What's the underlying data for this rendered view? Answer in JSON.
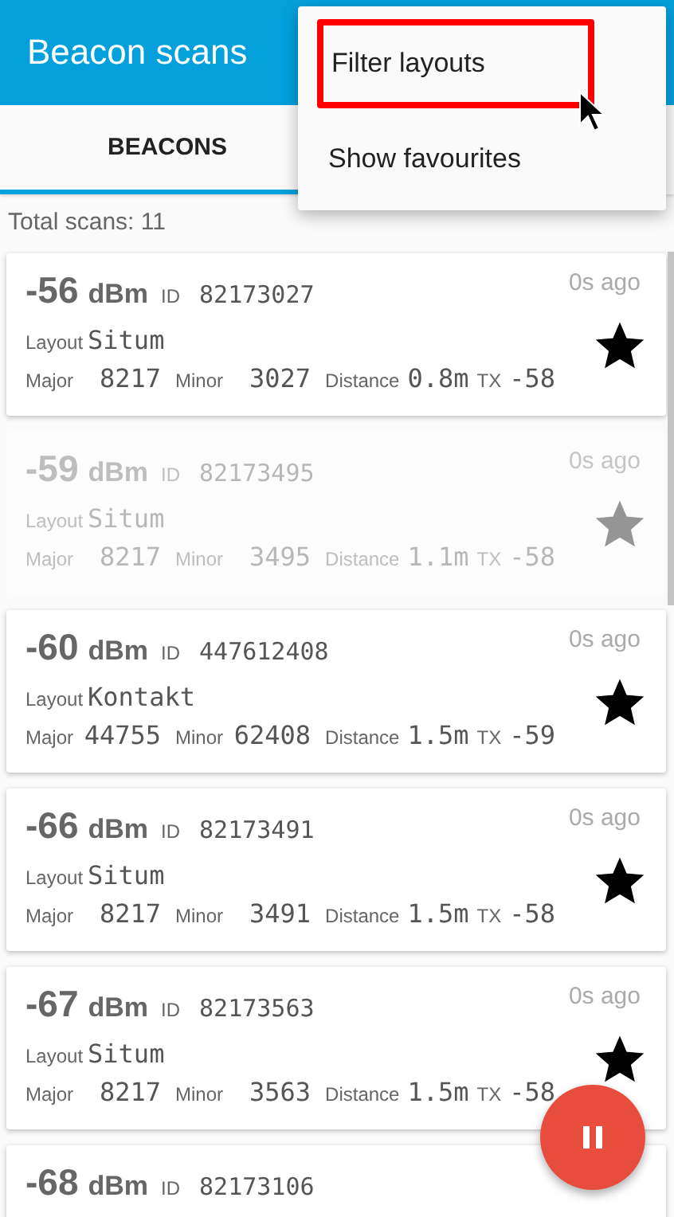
{
  "app_bar": {
    "title": "Beacon scans"
  },
  "tabs": [
    {
      "label": "BEACONS",
      "selected": true
    }
  ],
  "menu": {
    "items": [
      {
        "label": "Filter layouts",
        "highlighted": true
      },
      {
        "label": "Show favourites",
        "highlighted": false
      }
    ]
  },
  "total_scans": "Total scans: 11",
  "beacons": [
    {
      "signal": "-56",
      "unit": "dBm",
      "id_label": "ID",
      "id": "82173027",
      "time": "0s ago",
      "layout_label": "Layout",
      "layout": "Situm",
      "major_label": "Major",
      "major": "8217",
      "minor_label": "Minor",
      "minor": "3027",
      "distance_label": "Distance",
      "distance": "0.8m",
      "tx_label": "TX",
      "tx": "-58",
      "favourite": true,
      "faded": false
    },
    {
      "signal": "-59",
      "unit": "dBm",
      "id_label": "ID",
      "id": "82173495",
      "time": "0s ago",
      "layout_label": "Layout",
      "layout": "Situm",
      "major_label": "Major",
      "major": "8217",
      "minor_label": "Minor",
      "minor": "3495",
      "distance_label": "Distance",
      "distance": "1.1m",
      "tx_label": "TX",
      "tx": "-58",
      "favourite": true,
      "faded": true
    },
    {
      "signal": "-60",
      "unit": "dBm",
      "id_label": "ID",
      "id": "447612408",
      "time": "0s ago",
      "layout_label": "Layout",
      "layout": "Kontakt",
      "major_label": "Major",
      "major": "44755",
      "minor_label": "Minor",
      "minor": "62408",
      "distance_label": "Distance",
      "distance": "1.5m",
      "tx_label": "TX",
      "tx": "-59",
      "favourite": true,
      "faded": false
    },
    {
      "signal": "-66",
      "unit": "dBm",
      "id_label": "ID",
      "id": "82173491",
      "time": "0s ago",
      "layout_label": "Layout",
      "layout": "Situm",
      "major_label": "Major",
      "major": "8217",
      "minor_label": "Minor",
      "minor": "3491",
      "distance_label": "Distance",
      "distance": "1.5m",
      "tx_label": "TX",
      "tx": "-58",
      "favourite": true,
      "faded": false
    },
    {
      "signal": "-67",
      "unit": "dBm",
      "id_label": "ID",
      "id": "82173563",
      "time": "0s ago",
      "layout_label": "Layout",
      "layout": "Situm",
      "major_label": "Major",
      "major": "8217",
      "minor_label": "Minor",
      "minor": "3563",
      "distance_label": "Distance",
      "distance": "1.5m",
      "tx_label": "TX",
      "tx": "-58",
      "favourite": true,
      "faded": false
    },
    {
      "signal": "-68",
      "unit": "dBm",
      "id_label": "ID",
      "id": "82173106",
      "faded": false
    }
  ]
}
